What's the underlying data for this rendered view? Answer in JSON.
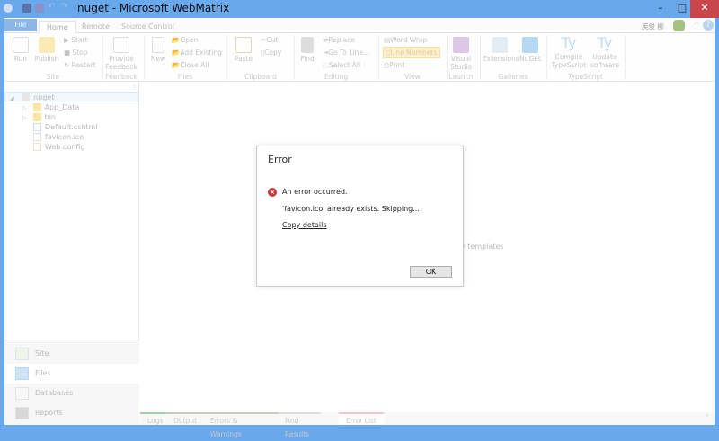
{
  "window": {
    "title": "nuget - Microsoft WebMatrix",
    "minimize": "–",
    "maximize": "□",
    "close": "✕"
  },
  "colors": {
    "frame": "#6aa8ec",
    "close": "#c9474a",
    "error": "#c8383d",
    "link": "#3a7cc7"
  },
  "tabs": [
    "File",
    "Home",
    "Remote",
    "Source Control"
  ],
  "user": {
    "name": "英俊 柳"
  },
  "ribbon": {
    "site": {
      "run": "Run",
      "publish": "Publish",
      "start": "Start",
      "stop": "Stop",
      "restart": "Restart",
      "group": "Site"
    },
    "feedback": {
      "provide": "Provide Feedback",
      "group": "Feedback"
    },
    "files": {
      "new": "New",
      "open": "Open",
      "add_existing": "Add Existing",
      "close_all": "Close All",
      "group": "Files"
    },
    "clipboard": {
      "paste": "Paste",
      "cut": "Cut",
      "copy": "Copy",
      "group": "Clipboard"
    },
    "editing": {
      "find": "Find",
      "replace": "Replace",
      "goto": "Go To Line...",
      "select_all": "Select All",
      "group": "Editing"
    },
    "view": {
      "word_wrap": "Word Wrap",
      "line_numbers": "Line Numbers",
      "print": "Print",
      "group": "View"
    },
    "launch": {
      "visual_studio": "Visual Studio",
      "group": "Launch"
    },
    "galleries": {
      "extensions": "Extensions",
      "nuget": "NuGet",
      "group": "Galleries"
    },
    "typescript": {
      "compile": "Compile TypeScript",
      "update": "Update software",
      "group": "TypeScript"
    }
  },
  "tree": {
    "root": "nuget",
    "items": [
      "App_Data",
      "bin",
      "Default.cshtml",
      "favicon.ico",
      "Web.config"
    ]
  },
  "nav": [
    "Site",
    "Files",
    "Databases",
    "Reports"
  ],
  "main": {
    "bg_text": "y templates"
  },
  "bottom_tabs": [
    "Logs",
    "Output",
    "Errors & Warnings",
    "Find Results",
    "Error List"
  ],
  "dialog": {
    "title": "Error",
    "message": "An error occurred.",
    "detail": "'favicon.ico' already exists. Skipping...",
    "link": "Copy details",
    "ok": "OK"
  }
}
